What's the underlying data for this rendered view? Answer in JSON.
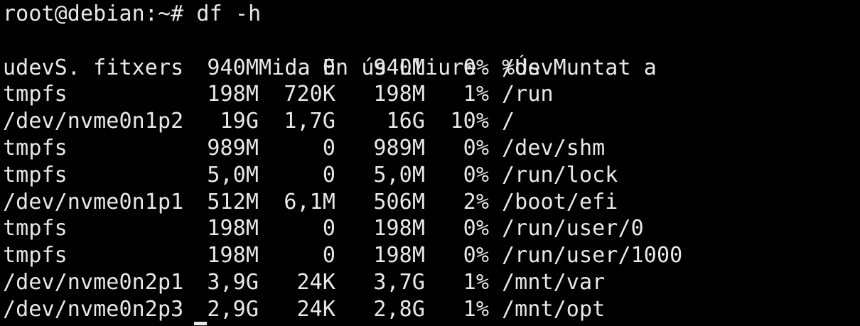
{
  "terminal": {
    "prompt": "root@debian:~# df -h",
    "header": {
      "filesystem": "S. fitxers",
      "size": "Mida",
      "used": "En ús",
      "avail": "Lliure",
      "use_pct": "%Ús",
      "mounted_on": "Muntat a"
    },
    "rows": [
      {
        "filesystem": "udev",
        "size": "940M",
        "used": "0",
        "avail": "940M",
        "use_pct": "0%",
        "mounted_on": "/dev"
      },
      {
        "filesystem": "tmpfs",
        "size": "198M",
        "used": "720K",
        "avail": "198M",
        "use_pct": "1%",
        "mounted_on": "/run"
      },
      {
        "filesystem": "/dev/nvme0n1p2",
        "size": "19G",
        "used": "1,7G",
        "avail": "16G",
        "use_pct": "10%",
        "mounted_on": "/"
      },
      {
        "filesystem": "tmpfs",
        "size": "989M",
        "used": "0",
        "avail": "989M",
        "use_pct": "0%",
        "mounted_on": "/dev/shm"
      },
      {
        "filesystem": "tmpfs",
        "size": "5,0M",
        "used": "0",
        "avail": "5,0M",
        "use_pct": "0%",
        "mounted_on": "/run/lock"
      },
      {
        "filesystem": "/dev/nvme0n1p1",
        "size": "512M",
        "used": "6,1M",
        "avail": "506M",
        "use_pct": "2%",
        "mounted_on": "/boot/efi"
      },
      {
        "filesystem": "tmpfs",
        "size": "198M",
        "used": "0",
        "avail": "198M",
        "use_pct": "0%",
        "mounted_on": "/run/user/0"
      },
      {
        "filesystem": "tmpfs",
        "size": "198M",
        "used": "0",
        "avail": "198M",
        "use_pct": "0%",
        "mounted_on": "/run/user/1000"
      },
      {
        "filesystem": "/dev/nvme0n2p1",
        "size": "3,9G",
        "used": "24K",
        "avail": "3,7G",
        "use_pct": "1%",
        "mounted_on": "/mnt/var"
      },
      {
        "filesystem": "/dev/nvme0n2p3",
        "size": "2,9G",
        "used": "24K",
        "avail": "2,8G",
        "use_pct": "1%",
        "mounted_on": "/mnt/opt"
      }
    ]
  },
  "colors": {
    "background": "#000000",
    "foreground": "#e8e8e8"
  }
}
